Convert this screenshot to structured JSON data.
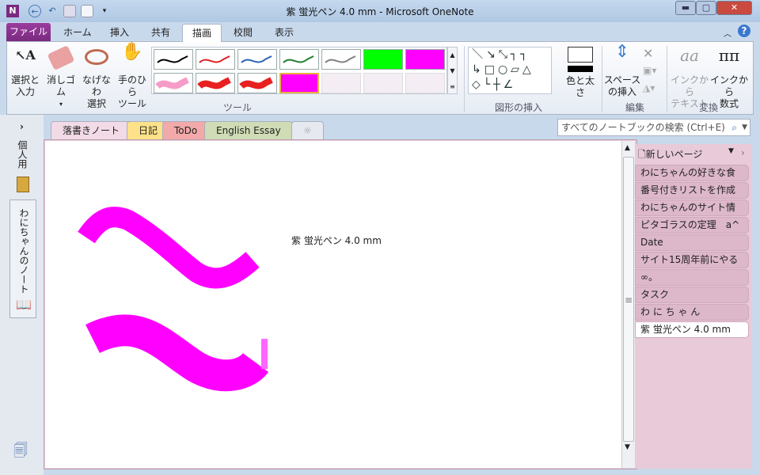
{
  "window": {
    "title": "紫 蛍光ペン 4.0 mm  -  Microsoft OneNote",
    "app_icon": "N",
    "min": "▬",
    "max": "▢",
    "close": "✕"
  },
  "ribbon_tabs": [
    "ファイル",
    "ホーム",
    "挿入",
    "共有",
    "描画",
    "校閲",
    "表示"
  ],
  "active_tab": "描画",
  "ribbon": {
    "select_line1": "選択と",
    "select_line2": "入力",
    "eraser": "消しゴム",
    "eraser_arrow": "▾",
    "lasso_line1": "なげなわ",
    "lasso_line2": "選択",
    "pan_line1": "手のひら",
    "pan_line2": "ツール",
    "tools_group": "ツール",
    "shapes_group": "図形の挿入",
    "color_width": "色と太さ",
    "insert_space_line1": "スペース",
    "insert_space_line2": "の挿入",
    "edit_group": "編集",
    "ink_to_text_line1": "インクから",
    "ink_to_text_line2": "テキスト",
    "ink_to_math_line1": "インクから",
    "ink_to_math_line2": "数式",
    "convert_group": "変換",
    "pens": [
      {
        "color": "#000000",
        "type": "pen"
      },
      {
        "color": "#e02020",
        "type": "pen"
      },
      {
        "color": "#2a64b8",
        "type": "pen"
      },
      {
        "color": "#1f7f2f",
        "type": "pen"
      },
      {
        "color": "#808080",
        "type": "pen"
      },
      {
        "color": "#00ff00",
        "type": "highlighter"
      },
      {
        "color": "#ff00ff",
        "type": "highlighter"
      },
      {
        "color": "#f79bc8",
        "type": "marker"
      },
      {
        "color": "#e82020",
        "type": "marker"
      },
      {
        "color": "#e82020",
        "type": "marker"
      },
      {
        "color": "#ff00ff",
        "type": "highlighter",
        "selected": true
      }
    ]
  },
  "search": {
    "placeholder": "すべてのノートブックの検索 (Ctrl+E)"
  },
  "nav": {
    "expand": "›",
    "notebooks": [
      "個人用",
      "わにちゃんのノート"
    ]
  },
  "section_tabs": [
    {
      "label": "落書きノート",
      "color": "#f2dbe6",
      "active": true
    },
    {
      "label": "日記",
      "color": "#fde28a"
    },
    {
      "label": "ToDo",
      "color": "#f2a9a9"
    },
    {
      "label": "English Essay",
      "color": "#cfdcb5"
    },
    {
      "label": "☼",
      "color": "#e6eaf0"
    }
  ],
  "page_content": {
    "text": "紫 蛍光ペン 4.0 mm",
    "ink_color": "#ff00ff"
  },
  "pages": {
    "new_page": "新しいページ",
    "items": [
      "わにちゃんの好きな食",
      "番号付きリストを作成",
      "わにちゃんのサイト情",
      "ピタゴラスの定理　a^",
      "Date",
      "サイト15周年前にやる",
      "∞。",
      "タスク",
      "わ に ち ゃ ん",
      "紫 蛍光ペン 4.0 mm"
    ],
    "selected": 9
  }
}
